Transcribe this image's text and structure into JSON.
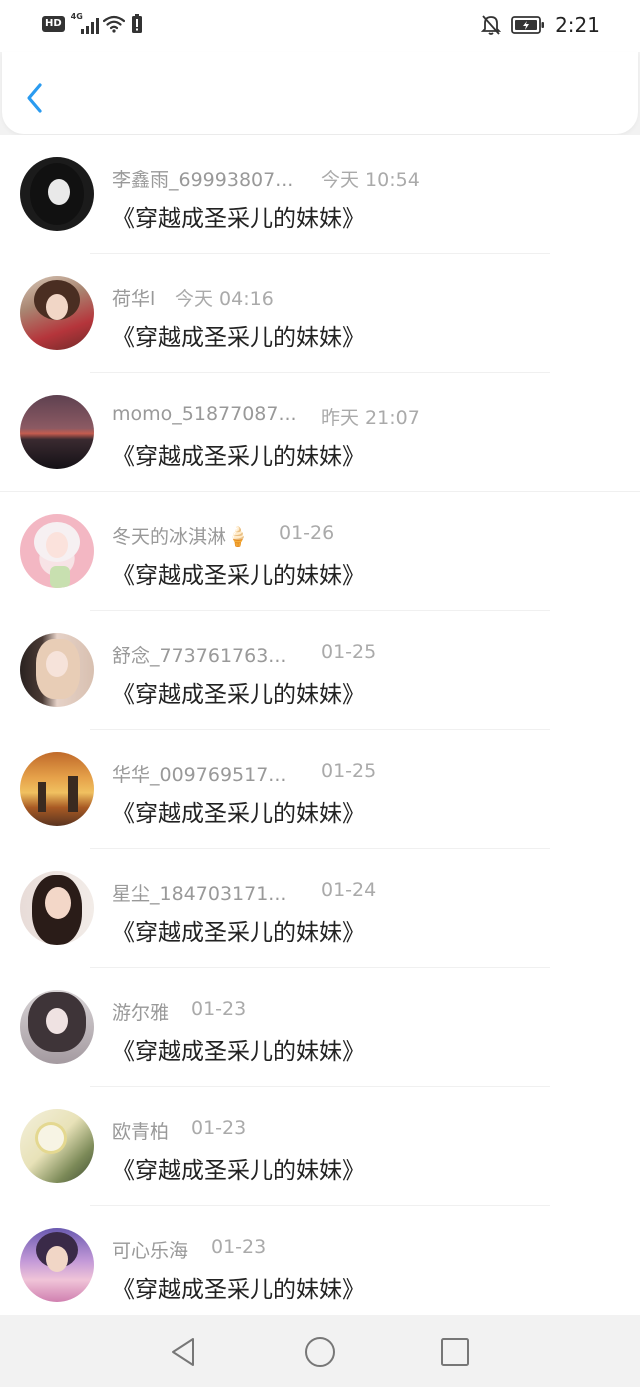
{
  "status_bar": {
    "hd": "HD",
    "network": "4G",
    "time": "2:21"
  },
  "header": {
    "back_icon": "chevron-left-icon",
    "accent_color": "#2a9bf0"
  },
  "items": [
    {
      "username": "李鑫雨_69993807...",
      "time": "今天 10:54",
      "title": "《穿越成圣采儿的妹妹》"
    },
    {
      "username": "荷华l",
      "time": "今天 04:16",
      "title": "《穿越成圣采儿的妹妹》"
    },
    {
      "username": "momo_51877087...",
      "time": "昨天 21:07",
      "title": "《穿越成圣采儿的妹妹》"
    },
    {
      "username": "冬天的冰淇淋🍦",
      "time": "01-26",
      "title": "《穿越成圣采儿的妹妹》"
    },
    {
      "username": "舒念_773761763...",
      "time": "01-25",
      "title": "《穿越成圣采儿的妹妹》"
    },
    {
      "username": "华华_009769517...",
      "time": "01-25",
      "title": "《穿越成圣采儿的妹妹》"
    },
    {
      "username": "星尘_184703171...",
      "time": "01-24",
      "title": "《穿越成圣采儿的妹妹》"
    },
    {
      "username": "游尔雅",
      "time": "01-23",
      "title": "《穿越成圣采儿的妹妹》"
    },
    {
      "username": "欧青柏",
      "time": "01-23",
      "title": "《穿越成圣采儿的妹妹》"
    },
    {
      "username": "可心乐海",
      "time": "01-23",
      "title": "《穿越成圣采儿的妹妹》"
    }
  ]
}
